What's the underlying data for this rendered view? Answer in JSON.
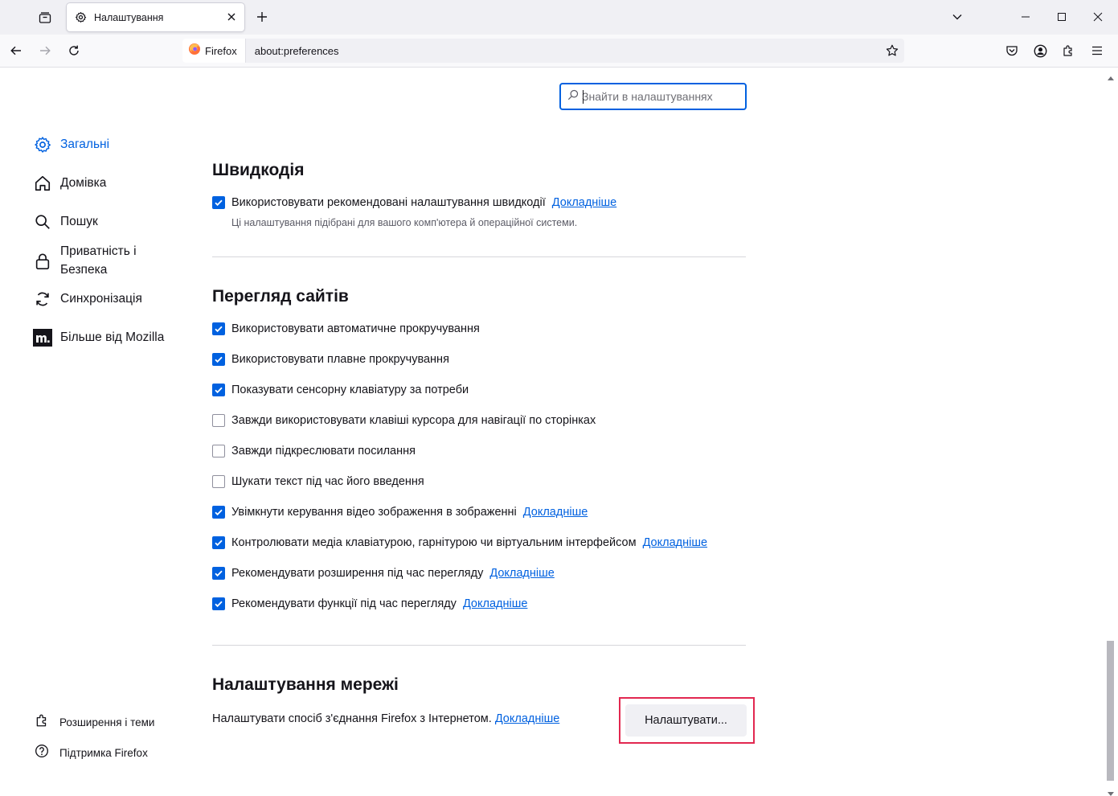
{
  "tab": {
    "title": "Налаштування"
  },
  "urlbar": {
    "identity_label": "Firefox",
    "url": "about:preferences"
  },
  "search": {
    "placeholder": "Знайти в налаштуваннях"
  },
  "sidebar": {
    "items": [
      {
        "label": "Загальні",
        "icon": "gear-icon",
        "selected": true
      },
      {
        "label": "Домівка",
        "icon": "home-icon"
      },
      {
        "label": "Пошук",
        "icon": "search-icon"
      },
      {
        "label": "Приватність і Безпека",
        "icon": "lock-icon"
      },
      {
        "label": "Синхронізація",
        "icon": "sync-icon"
      },
      {
        "label": "Більше від Mozilla",
        "icon": "mozilla-icon"
      }
    ],
    "footer": [
      {
        "label": "Розширення і теми",
        "icon": "puzzle-icon"
      },
      {
        "label": "Підтримка Firefox",
        "icon": "help-icon"
      }
    ]
  },
  "performance": {
    "heading": "Швидкодія",
    "recommended_label": "Використовувати рекомендовані налаштування швидкодії",
    "recommended_checked": true,
    "learn_more": "Докладніше",
    "description": "Ці налаштування підібрані для вашого комп'ютера й операційної системи."
  },
  "browsing": {
    "heading": "Перегляд сайтів",
    "options": [
      {
        "label": "Використовувати автоматичне прокручування",
        "checked": true
      },
      {
        "label": "Використовувати плавне прокручування",
        "checked": true
      },
      {
        "label": "Показувати сенсорну клавіатуру за потреби",
        "checked": true
      },
      {
        "label": "Завжди використовувати клавіші курсора для навігації по сторінках",
        "checked": false
      },
      {
        "label": "Завжди підкреслювати посилання",
        "checked": false
      },
      {
        "label": "Шукати текст під час його введення",
        "checked": false
      },
      {
        "label": "Увімкнути керування відео зображення в зображенні",
        "checked": true,
        "learn_more": "Докладніше"
      },
      {
        "label": "Контролювати медіа клавіатурою, гарнітурою чи віртуальним інтерфейсом",
        "checked": true,
        "learn_more": "Докладніше"
      },
      {
        "label": "Рекомендувати розширення під час перегляду",
        "checked": true,
        "learn_more": "Докладніше"
      },
      {
        "label": "Рекомендувати функції під час перегляду",
        "checked": true,
        "learn_more": "Докладніше"
      }
    ]
  },
  "network": {
    "heading": "Налаштування мережі",
    "description": "Налаштувати спосіб з'єднання Firefox з Інтернетом.",
    "learn_more": "Докладніше",
    "button": "Налаштувати..."
  },
  "colors": {
    "accent": "#0061e0",
    "highlight_border": "#e22850"
  }
}
